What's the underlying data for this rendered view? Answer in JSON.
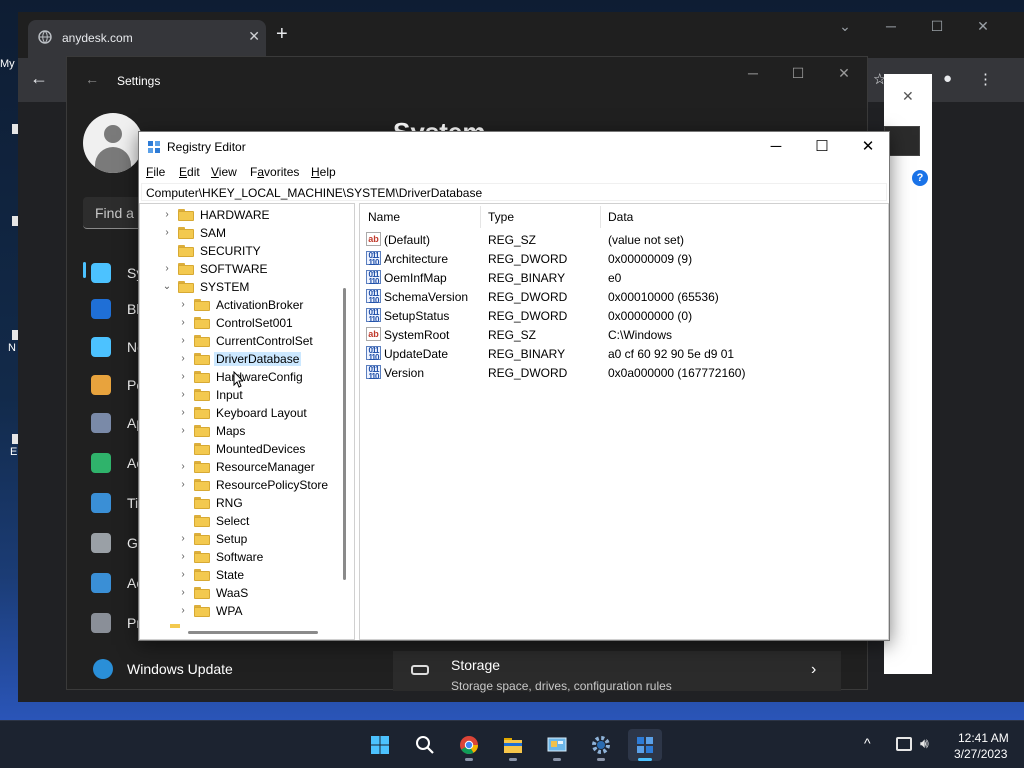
{
  "browser": {
    "tab_title": "anydesk.com",
    "tab_close": "✕",
    "new_tab": "+",
    "back": "←"
  },
  "desktop": {
    "icons": [
      "My",
      "N",
      "E"
    ]
  },
  "settings": {
    "title": "Settings",
    "heading": "System",
    "search_placeholder": "Find a setting",
    "nav": [
      {
        "label": "System",
        "icon": "monitor-icon",
        "color": "#4cc2ff"
      },
      {
        "label": "Bluetooth & devices",
        "icon": "bluetooth-icon",
        "color": "#1f6fd6"
      },
      {
        "label": "Network & internet",
        "icon": "wifi-icon",
        "color": "#4cc2ff"
      },
      {
        "label": "Personalization",
        "icon": "brush-icon",
        "color": "#e8a33d"
      },
      {
        "label": "Apps",
        "icon": "apps-icon",
        "color": "#7a8aa8"
      },
      {
        "label": "Accounts",
        "icon": "person-icon",
        "color": "#2fb36b"
      },
      {
        "label": "Time & language",
        "icon": "clock-globe-icon",
        "color": "#3a8fd6"
      },
      {
        "label": "Gaming",
        "icon": "gamepad-icon",
        "color": "#9aa0a6"
      },
      {
        "label": "Accessibility",
        "icon": "accessibility-icon",
        "color": "#3a8fd6"
      },
      {
        "label": "Privacy & security",
        "icon": "shield-icon",
        "color": "#8a8f98"
      }
    ],
    "windows_update": "Windows Update",
    "storage": {
      "title": "Storage",
      "subtitle": "Storage space, drives, configuration rules"
    }
  },
  "regedit": {
    "title": "Registry Editor",
    "menus": [
      {
        "key": "F",
        "rest": "ile"
      },
      {
        "key": "E",
        "rest": "dit"
      },
      {
        "key": "V",
        "rest": "iew"
      },
      {
        "key": "",
        "pre": "F",
        "mid": "a",
        "rest": "vorites"
      },
      {
        "key": "H",
        "rest": "elp"
      }
    ],
    "address": "Computer\\HKEY_LOCAL_MACHINE\\SYSTEM\\DriverDatabase",
    "tree": [
      {
        "label": "HARDWARE",
        "level": 0,
        "expander": "collapsed"
      },
      {
        "label": "SAM",
        "level": 0,
        "expander": "collapsed"
      },
      {
        "label": "SECURITY",
        "level": 0,
        "expander": "none"
      },
      {
        "label": "SOFTWARE",
        "level": 0,
        "expander": "collapsed"
      },
      {
        "label": "SYSTEM",
        "level": 0,
        "expander": "expanded"
      },
      {
        "label": "ActivationBroker",
        "level": 1,
        "expander": "collapsed"
      },
      {
        "label": "ControlSet001",
        "level": 1,
        "expander": "collapsed"
      },
      {
        "label": "CurrentControlSet",
        "level": 1,
        "expander": "collapsed"
      },
      {
        "label": "DriverDatabase",
        "level": 1,
        "expander": "collapsed",
        "selected": true
      },
      {
        "label": "HardwareConfig",
        "level": 1,
        "expander": "collapsed"
      },
      {
        "label": "Input",
        "level": 1,
        "expander": "collapsed"
      },
      {
        "label": "Keyboard Layout",
        "level": 1,
        "expander": "collapsed"
      },
      {
        "label": "Maps",
        "level": 1,
        "expander": "collapsed"
      },
      {
        "label": "MountedDevices",
        "level": 1,
        "expander": "none"
      },
      {
        "label": "ResourceManager",
        "level": 1,
        "expander": "collapsed"
      },
      {
        "label": "ResourcePolicyStore",
        "level": 1,
        "expander": "collapsed"
      },
      {
        "label": "RNG",
        "level": 1,
        "expander": "none"
      },
      {
        "label": "Select",
        "level": 1,
        "expander": "none"
      },
      {
        "label": "Setup",
        "level": 1,
        "expander": "collapsed"
      },
      {
        "label": "Software",
        "level": 1,
        "expander": "collapsed"
      },
      {
        "label": "State",
        "level": 1,
        "expander": "collapsed"
      },
      {
        "label": "WaaS",
        "level": 1,
        "expander": "collapsed"
      },
      {
        "label": "WPA",
        "level": 1,
        "expander": "collapsed"
      }
    ],
    "columns": {
      "name": "Name",
      "type": "Type",
      "data": "Data"
    },
    "values": [
      {
        "name": "(Default)",
        "type": "REG_SZ",
        "data": "(value not set)",
        "kind": "sz"
      },
      {
        "name": "Architecture",
        "type": "REG_DWORD",
        "data": "0x00000009 (9)",
        "kind": "bin"
      },
      {
        "name": "OemInfMap",
        "type": "REG_BINARY",
        "data": "e0",
        "kind": "bin"
      },
      {
        "name": "SchemaVersion",
        "type": "REG_DWORD",
        "data": "0x00010000 (65536)",
        "kind": "bin"
      },
      {
        "name": "SetupStatus",
        "type": "REG_DWORD",
        "data": "0x00000000 (0)",
        "kind": "bin"
      },
      {
        "name": "SystemRoot",
        "type": "REG_SZ",
        "data": "C:\\Windows",
        "kind": "sz"
      },
      {
        "name": "UpdateDate",
        "type": "REG_BINARY",
        "data": "a0 cf 60 92 90 5e d9 01",
        "kind": "bin"
      },
      {
        "name": "Version",
        "type": "REG_DWORD",
        "data": "0x0a000000 (167772160)",
        "kind": "bin"
      }
    ]
  },
  "taskbar": {
    "apps": [
      {
        "name": "start-button",
        "icon": "windows-logo-icon"
      },
      {
        "name": "search-button",
        "icon": "search-icon"
      },
      {
        "name": "chrome-app",
        "icon": "chrome-icon"
      },
      {
        "name": "file-explorer-app",
        "icon": "folder-icon"
      },
      {
        "name": "control-panel-app",
        "icon": "control-panel-icon"
      },
      {
        "name": "settings-app",
        "icon": "gear-icon"
      },
      {
        "name": "regedit-app",
        "icon": "registry-icon",
        "active": true
      }
    ],
    "tray_chevron": "^",
    "time": "12:41 AM",
    "date": "3/27/2023"
  }
}
